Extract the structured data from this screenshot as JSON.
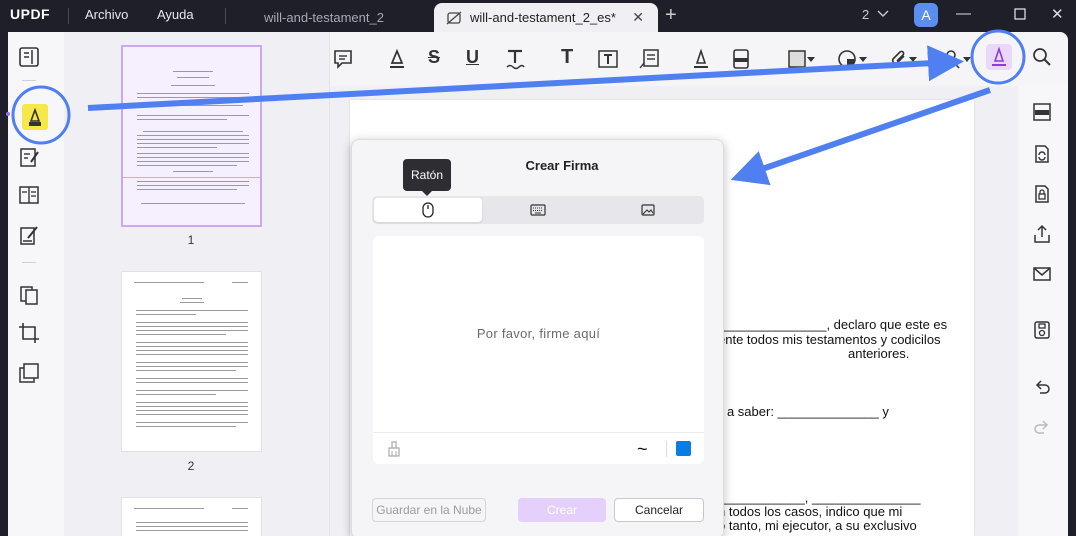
{
  "app": {
    "logo_up": "UPDF"
  },
  "menu": {
    "file": "Archivo",
    "help": "Ayuda"
  },
  "tabs": [
    {
      "label": "will-and-testament_2"
    },
    {
      "label": "will-and-testament_2_es*"
    }
  ],
  "header": {
    "window_count": "2",
    "avatar_letter": "A"
  },
  "thumbnails": [
    {
      "number": "1"
    },
    {
      "number": "2"
    }
  ],
  "document": {
    "lines": [
      "_______________, declaro que este es",
      "ente todos mis testamentos y codicilos",
      "anteriores.",
      "os, a saber: ______________ y",
      "____________,  _______________",
      "n todos los casos, indico que mi",
      "o tanto, mi ejecutor, a su exclusivo"
    ]
  },
  "dialog": {
    "title": "Crear Firma",
    "tooltip": "Ratón",
    "placeholder": "Por favor, firme aquí",
    "cloud_button": "Guardar en la Nube",
    "create_button": "Crear",
    "cancel_button": "Cancelar",
    "stroke_symbol": "~",
    "selected_color": "#0a7ce6"
  },
  "annotation_color": "#4f7ff0"
}
